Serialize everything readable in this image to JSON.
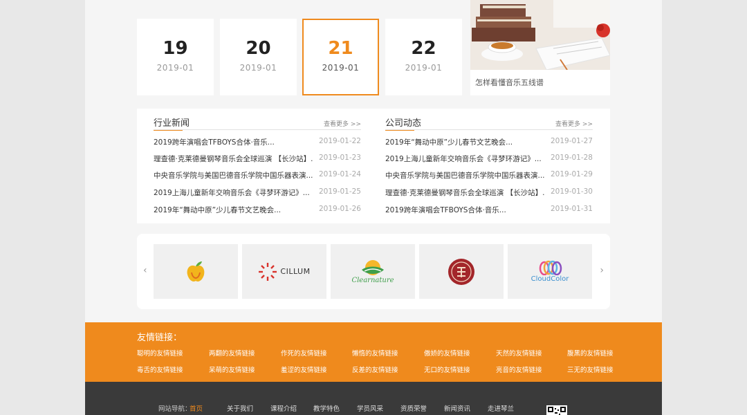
{
  "dates": [
    {
      "day": "19",
      "ym": "2019-01",
      "active": false
    },
    {
      "day": "20",
      "ym": "2019-01",
      "active": false
    },
    {
      "day": "21",
      "ym": "2019-01",
      "active": true
    },
    {
      "day": "22",
      "ym": "2019-01",
      "active": false
    }
  ],
  "featured": {
    "caption": "怎样看懂音乐五线谱"
  },
  "industry_news": {
    "title": "行业新闻",
    "more": "查看更多 >>",
    "items": [
      {
        "title": "2019跨年演唱会TFBOYS合体·音乐...",
        "date": "2019-01-22"
      },
      {
        "title": "理查德·克莱德曼钢琴音乐会全球巡演 【长沙站】...",
        "date": "2019-01-23"
      },
      {
        "title": "中央音乐学院与美国巴德音乐学院中国乐器表演...",
        "date": "2019-01-24"
      },
      {
        "title": "2019上海儿童新年交响音乐会《寻梦环游记》...",
        "date": "2019-01-25"
      },
      {
        "title": "2019年“舞动中原”少儿春节文艺晚会...",
        "date": "2019-01-26"
      }
    ]
  },
  "company_news": {
    "title": "公司动态",
    "more": "查看更多 >>",
    "items": [
      {
        "title": "2019年“舞动中原”少儿春节文艺晚会...",
        "date": "2019-01-27"
      },
      {
        "title": "2019上海儿童新年交响音乐会《寻梦环游记》...",
        "date": "2019-01-28"
      },
      {
        "title": "中央音乐学院与美国巴德音乐学院中国乐器表演...",
        "date": "2019-01-29"
      },
      {
        "title": "理查德·克莱德曼钢琴音乐会全球巡演 【长沙站】...",
        "date": "2019-01-30"
      },
      {
        "title": "2019跨年演唱会TFBOYS合体·音乐...",
        "date": "2019-01-31"
      }
    ]
  },
  "carousel": {
    "prev": "‹",
    "next": "›",
    "logos": [
      {
        "name": "apple-logo",
        "text": ""
      },
      {
        "name": "cillum-logo",
        "text": "CILLUM"
      },
      {
        "name": "clearnature-logo",
        "text": "Clearnature"
      },
      {
        "name": "seal-logo",
        "text": ""
      },
      {
        "name": "cloudcolor-logo",
        "text": "CloudColor"
      }
    ]
  },
  "friend_links": {
    "title": "友情链接：",
    "row1": [
      "聪明的友情链接",
      "两翻的友情链接",
      "作死的友情链接",
      "懒惰的友情链接",
      "傲娇的友情链接",
      "天然的友情链接",
      "腹黑的友情链接"
    ],
    "row2": [
      "毒舌的友情链接",
      "呆萌的友情链接",
      "羞涩的友情链接",
      "反差的友情链接",
      "无口的友情链接",
      "亮音的友情链接",
      "三无的友情链接"
    ]
  },
  "footer": {
    "nav_label": "网站导航：",
    "nav": [
      "首页",
      "关于我们",
      "课程介绍",
      "教学特色",
      "学员风采",
      "资质荣誉",
      "新闻资讯",
      "走进琴兰"
    ]
  },
  "colors": {
    "accent": "#ef8a1d",
    "footer_bg": "#3a3a3a"
  }
}
